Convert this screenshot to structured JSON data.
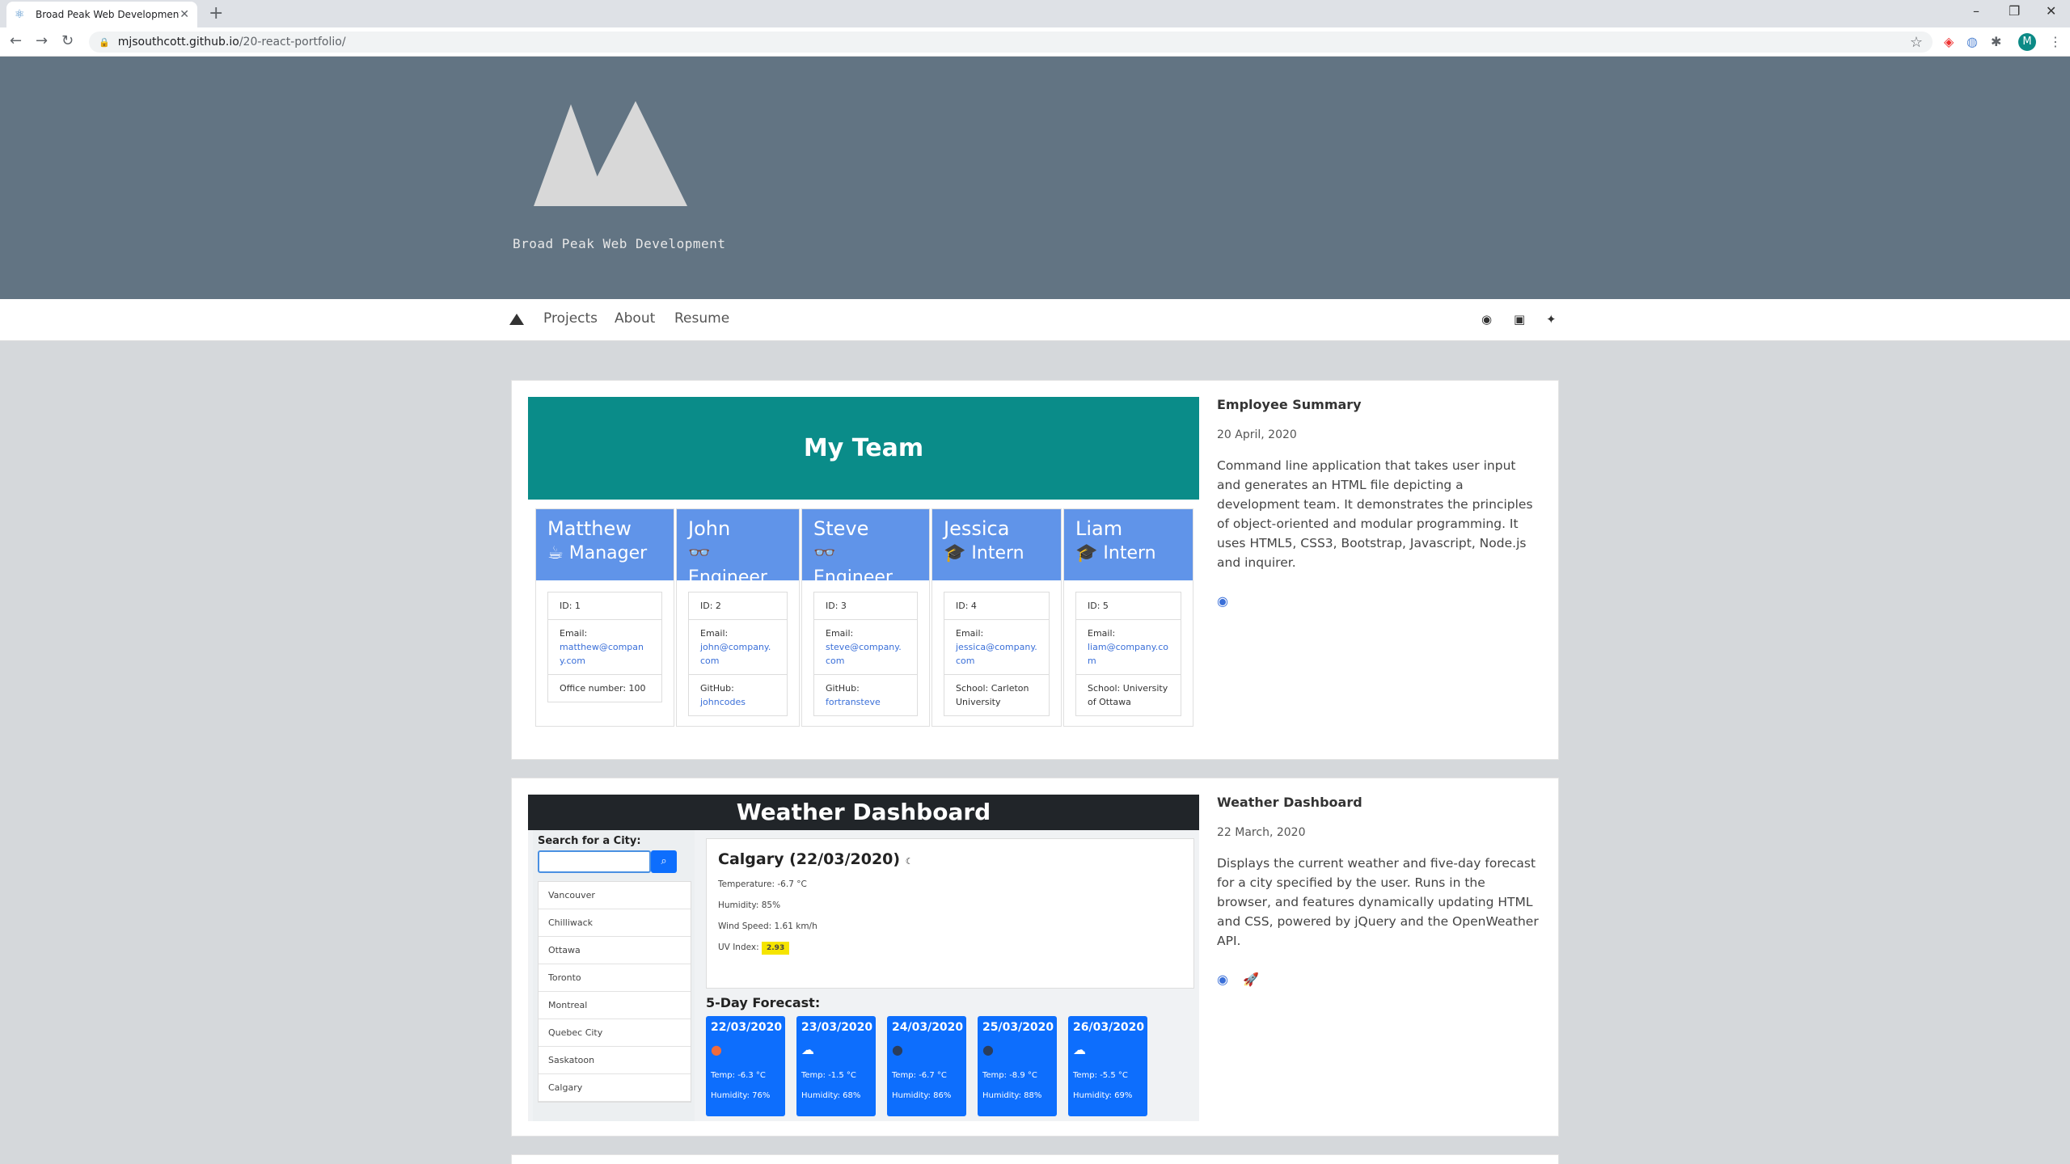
{
  "browser": {
    "tab_title": "Broad Peak Web Development",
    "url_host": "mjsouthcott.github.io",
    "url_path": "/20-react-portfolio/",
    "profile_initial": "M"
  },
  "site": {
    "brand": "Broad Peak Web Development",
    "nav": [
      "Projects",
      "About",
      "Resume"
    ]
  },
  "projects": [
    {
      "title": "Employee Summary",
      "date": "20 April, 2020",
      "description": "Command line application that takes user input and generates an HTML file depicting a development team. It demonstrates the principles of object-oriented and modular programming. It uses HTML5, CSS3, Bootstrap, Javascript, Node.js and inquirer."
    },
    {
      "title": "Weather Dashboard",
      "date": "22 March, 2020",
      "description": "Displays the current weather and five-day forecast for a city specified by the user. Runs in the browser, and features dynamically updating HTML and CSS, powered by jQuery and the OpenWeather API."
    }
  ],
  "team": {
    "heading": "My Team",
    "employees": [
      {
        "name": "Matthew",
        "role": "Manager",
        "icon": "coffee-icon",
        "id": "ID: 1",
        "email_label": "Email:",
        "email": "matthew@company.com",
        "extra": "Office number: 100",
        "extra_label": "",
        "extra_link": ""
      },
      {
        "name": "John",
        "role": "Engineer",
        "icon": "glasses-icon",
        "id": "ID: 2",
        "email_label": "Email:",
        "email": "john@company.com",
        "extra": "",
        "extra_label": "GitHub:",
        "extra_link": "johncodes"
      },
      {
        "name": "Steve",
        "role": "Engineer",
        "icon": "glasses-icon",
        "id": "ID: 3",
        "email_label": "Email:",
        "email": "steve@company.com",
        "extra": "",
        "extra_label": "GitHub:",
        "extra_link": "fortransteve"
      },
      {
        "name": "Jessica",
        "role": "Intern",
        "icon": "graduate-icon",
        "id": "ID: 4",
        "email_label": "Email:",
        "email": "jessica@company.com",
        "extra": "School: Carleton University",
        "extra_label": "",
        "extra_link": ""
      },
      {
        "name": "Liam",
        "role": "Intern",
        "icon": "graduate-icon",
        "id": "ID: 5",
        "email_label": "Email:",
        "email": "liam@company.com",
        "extra": "School: University of Ottawa",
        "extra_label": "",
        "extra_link": ""
      }
    ]
  },
  "weather": {
    "heading": "Weather Dashboard",
    "search_label": "Search for a City:",
    "cities": [
      "Vancouver",
      "Chilliwack",
      "Ottawa",
      "Toronto",
      "Montreal",
      "Quebec City",
      "Saskatoon",
      "Calgary"
    ],
    "current": {
      "city": "Calgary (22/03/2020)",
      "temperature": "Temperature: -6.7 °C",
      "humidity": "Humidity: 85%",
      "wind": "Wind Speed: 1.61 km/h",
      "uv_label": "UV Index:",
      "uv_value": "2.93"
    },
    "forecast_title": "5-Day Forecast:",
    "forecast": [
      {
        "date": "22/03/2020",
        "temp": "Temp: -6.3 °C",
        "humidity": "Humidity: 76%",
        "icon": "sun-icon"
      },
      {
        "date": "23/03/2020",
        "temp": "Temp: -1.5 °C",
        "humidity": "Humidity: 68%",
        "icon": "cloud-icon"
      },
      {
        "date": "24/03/2020",
        "temp": "Temp: -6.7 °C",
        "humidity": "Humidity: 86%",
        "icon": "moon-icon"
      },
      {
        "date": "25/03/2020",
        "temp": "Temp: -8.9 °C",
        "humidity": "Humidity: 88%",
        "icon": "moon-icon"
      },
      {
        "date": "26/03/2020",
        "temp": "Temp: -5.5 °C",
        "humidity": "Humidity: 69%",
        "icon": "cloud-icon"
      }
    ]
  },
  "colors": {
    "hero": "#627483",
    "teal": "#0a8c89",
    "team_blue": "#6094e9",
    "forecast_blue": "#0d6efd"
  }
}
